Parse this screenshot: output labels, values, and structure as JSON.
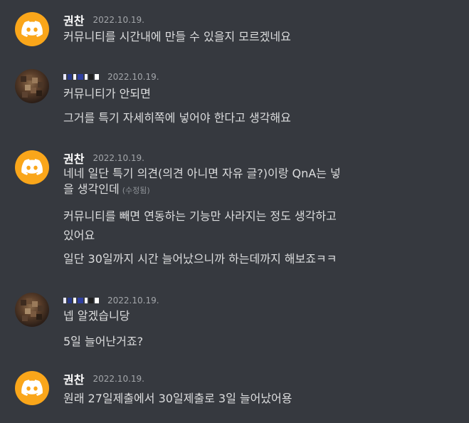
{
  "messages": [
    {
      "author": "권찬",
      "avatar": "discord-logo",
      "timestamp": "2022.10.19.",
      "lines": [
        "커뮤니티를 시간내에 만들 수 있을지 모르겠네요"
      ]
    },
    {
      "author": "",
      "avatar": "photo",
      "timestamp": "2022.10.19.",
      "lines": [
        "커뮤니티가 안되면",
        "그거를 특기 자세히쪽에 넣어야 한다고 생각해요"
      ]
    },
    {
      "author": "권찬",
      "avatar": "discord-logo",
      "timestamp": "2022.10.19.",
      "lines": [
        "네네 일단 특기 의견(의견 아니면 자유 글?)이랑 QnA는 넣",
        "을 생각인데",
        "커뮤니티를 빼면 연동하는 기능만 사라지는 정도 생각하고",
        "있어요",
        "일단 30일까지 시간 늘어났으니까 하는데까지 해보죠ㅋㅋ"
      ],
      "edited_note": "(수정됨)"
    },
    {
      "author": "",
      "avatar": "photo",
      "timestamp": "2022.10.19.",
      "lines": [
        "넵 알겠습니당",
        "5일 늘어난거죠?"
      ]
    },
    {
      "author": "권찬",
      "avatar": "discord-logo",
      "timestamp": "2022.10.19.",
      "lines": [
        "원래 27일제출에서 30일제출로 3일 늘어났어용"
      ]
    }
  ],
  "colors": {
    "background": "#36393f",
    "discord_avatar": "#faa61a",
    "text": "#dcddde",
    "username": "#ffffff",
    "timestamp": "#a3a6aa"
  }
}
